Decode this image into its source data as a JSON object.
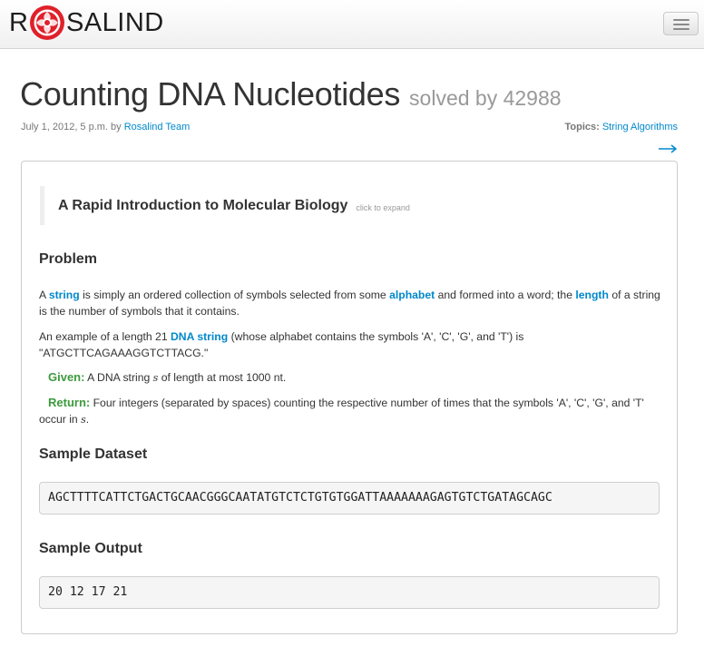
{
  "brand": {
    "left": "R",
    "right": "SALIND",
    "logo_icon": "rosalind-logo-icon",
    "logo_color": "#e0202a"
  },
  "nav": {
    "toggle_icon": "hamburger-menu-icon"
  },
  "problem": {
    "title": "Counting DNA Nucleotides",
    "solved": "solved by 42988",
    "date": "July 1, 2012, 5 p.m. by ",
    "author": "Rosalind Team",
    "topics_label": "Topics:",
    "topic": "String Algorithms",
    "next_icon": "right-arrow-icon"
  },
  "intro": {
    "title": "A Rapid Introduction to Molecular Biology",
    "hint": "click to expand"
  },
  "sections": {
    "problem": "Problem",
    "sample_dataset": "Sample Dataset",
    "sample_output": "Sample Output"
  },
  "para1": {
    "t1": "A ",
    "term1": "string",
    "t2": " is simply an ordered collection of symbols selected from some ",
    "term2": "alphabet",
    "t3": " and formed into a word; the ",
    "term3": "length",
    "t4": " of a string is the number of symbols that it contains."
  },
  "para2": {
    "t1": "An example of a length 21 ",
    "term1": "DNA string",
    "t2": " (whose alphabet contains the symbols 'A', 'C', 'G', and 'T') is \"ATGCTTCAGAAAGGTCTTACG.\""
  },
  "given": {
    "label": "Given:",
    "t1": " A DNA string ",
    "var": "s",
    "t2": " of length at most 1000 nt."
  },
  "return": {
    "label": "Return:",
    "t1": " Four integers (separated by spaces) counting the respective number of times that the symbols 'A', 'C', 'G', and 'T' occur in ",
    "var": "s",
    "t2": "."
  },
  "dataset": "AGCTTTTCATTCTGACTGCAACGGGCAATATGTCTCTGTGTGGATTAAAAAAAGAGTGTCTGATAGCAGC",
  "output": "20 12 17 21",
  "colors": {
    "link": "#0088cc",
    "green": "#3d9a3d",
    "title_gray": "#999999"
  }
}
